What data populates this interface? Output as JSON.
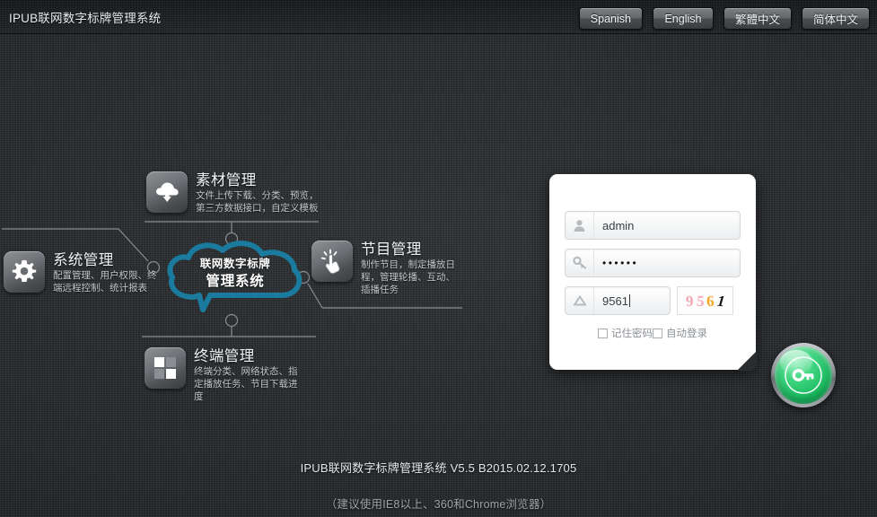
{
  "header": {
    "app_title": "IPUB联网数字标牌管理系统",
    "languages": [
      {
        "label": "Spanish",
        "name": "lang-spanish"
      },
      {
        "label": "English",
        "name": "lang-english"
      },
      {
        "label": "繁體中文",
        "name": "lang-traditional-chinese"
      },
      {
        "label": "简体中文",
        "name": "lang-simplified-chinese"
      }
    ]
  },
  "diagram": {
    "cloud": {
      "line1": "联网数字标牌",
      "line2": "管理系统",
      "outline_color": "#1a7b9e"
    },
    "features": [
      {
        "id": "material",
        "title": "素材管理",
        "desc": "文件上传下载、分类、预览，第三方数据接口，自定义模板",
        "icon": "cloud-download-icon"
      },
      {
        "id": "system",
        "title": "系统管理",
        "desc": "配置管理、用户权限、终端远程控制、统计报表",
        "icon": "gear-icon"
      },
      {
        "id": "program",
        "title": "节目管理",
        "desc": "制作节目，制定播放日程，管理轮播、互动、插播任务",
        "icon": "click-hand-icon"
      },
      {
        "id": "terminal",
        "title": "终端管理",
        "desc": "终端分类、网络状态、指定播放任务、节目下载进度",
        "icon": "grid-squares-icon"
      }
    ]
  },
  "login": {
    "username": {
      "value": "admin",
      "placeholder": "admin",
      "icon": "user-icon"
    },
    "password": {
      "value": "••••••",
      "masked_length": 6,
      "icon": "key-icon"
    },
    "captcha": {
      "value": "9561",
      "icon": "caret-up-icon",
      "image_chars": [
        "9",
        "5",
        "6",
        "1"
      ],
      "image_colors": [
        "#f6a7b4",
        "#f5aab6",
        "#f5a623",
        "#111111"
      ]
    },
    "remember_password": {
      "label": "记住密码",
      "checked": false
    },
    "auto_login": {
      "label": "自动登录",
      "checked": false
    },
    "submit": {
      "icon": "key-login-icon",
      "accent_color": "#17b85c"
    }
  },
  "footer": {
    "version": "IPUB联网数字标牌管理系统 V5.5 B2015.02.12.1705",
    "note": "（建议使用IE8以上、360和Chrome浏览器）"
  }
}
